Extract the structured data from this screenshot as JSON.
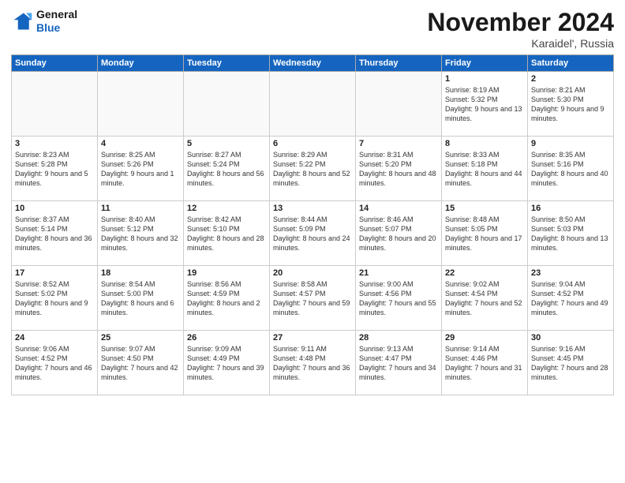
{
  "header": {
    "logo_line1": "General",
    "logo_line2": "Blue",
    "month_title": "November 2024",
    "location": "Karaidel', Russia"
  },
  "weekdays": [
    "Sunday",
    "Monday",
    "Tuesday",
    "Wednesday",
    "Thursday",
    "Friday",
    "Saturday"
  ],
  "weeks": [
    [
      {
        "day": "",
        "info": ""
      },
      {
        "day": "",
        "info": ""
      },
      {
        "day": "",
        "info": ""
      },
      {
        "day": "",
        "info": ""
      },
      {
        "day": "",
        "info": ""
      },
      {
        "day": "1",
        "info": "Sunrise: 8:19 AM\nSunset: 5:32 PM\nDaylight: 9 hours and 13 minutes."
      },
      {
        "day": "2",
        "info": "Sunrise: 8:21 AM\nSunset: 5:30 PM\nDaylight: 9 hours and 9 minutes."
      }
    ],
    [
      {
        "day": "3",
        "info": "Sunrise: 8:23 AM\nSunset: 5:28 PM\nDaylight: 9 hours and 5 minutes."
      },
      {
        "day": "4",
        "info": "Sunrise: 8:25 AM\nSunset: 5:26 PM\nDaylight: 9 hours and 1 minute."
      },
      {
        "day": "5",
        "info": "Sunrise: 8:27 AM\nSunset: 5:24 PM\nDaylight: 8 hours and 56 minutes."
      },
      {
        "day": "6",
        "info": "Sunrise: 8:29 AM\nSunset: 5:22 PM\nDaylight: 8 hours and 52 minutes."
      },
      {
        "day": "7",
        "info": "Sunrise: 8:31 AM\nSunset: 5:20 PM\nDaylight: 8 hours and 48 minutes."
      },
      {
        "day": "8",
        "info": "Sunrise: 8:33 AM\nSunset: 5:18 PM\nDaylight: 8 hours and 44 minutes."
      },
      {
        "day": "9",
        "info": "Sunrise: 8:35 AM\nSunset: 5:16 PM\nDaylight: 8 hours and 40 minutes."
      }
    ],
    [
      {
        "day": "10",
        "info": "Sunrise: 8:37 AM\nSunset: 5:14 PM\nDaylight: 8 hours and 36 minutes."
      },
      {
        "day": "11",
        "info": "Sunrise: 8:40 AM\nSunset: 5:12 PM\nDaylight: 8 hours and 32 minutes."
      },
      {
        "day": "12",
        "info": "Sunrise: 8:42 AM\nSunset: 5:10 PM\nDaylight: 8 hours and 28 minutes."
      },
      {
        "day": "13",
        "info": "Sunrise: 8:44 AM\nSunset: 5:09 PM\nDaylight: 8 hours and 24 minutes."
      },
      {
        "day": "14",
        "info": "Sunrise: 8:46 AM\nSunset: 5:07 PM\nDaylight: 8 hours and 20 minutes."
      },
      {
        "day": "15",
        "info": "Sunrise: 8:48 AM\nSunset: 5:05 PM\nDaylight: 8 hours and 17 minutes."
      },
      {
        "day": "16",
        "info": "Sunrise: 8:50 AM\nSunset: 5:03 PM\nDaylight: 8 hours and 13 minutes."
      }
    ],
    [
      {
        "day": "17",
        "info": "Sunrise: 8:52 AM\nSunset: 5:02 PM\nDaylight: 8 hours and 9 minutes."
      },
      {
        "day": "18",
        "info": "Sunrise: 8:54 AM\nSunset: 5:00 PM\nDaylight: 8 hours and 6 minutes."
      },
      {
        "day": "19",
        "info": "Sunrise: 8:56 AM\nSunset: 4:59 PM\nDaylight: 8 hours and 2 minutes."
      },
      {
        "day": "20",
        "info": "Sunrise: 8:58 AM\nSunset: 4:57 PM\nDaylight: 7 hours and 59 minutes."
      },
      {
        "day": "21",
        "info": "Sunrise: 9:00 AM\nSunset: 4:56 PM\nDaylight: 7 hours and 55 minutes."
      },
      {
        "day": "22",
        "info": "Sunrise: 9:02 AM\nSunset: 4:54 PM\nDaylight: 7 hours and 52 minutes."
      },
      {
        "day": "23",
        "info": "Sunrise: 9:04 AM\nSunset: 4:52 PM\nDaylight: 7 hours and 49 minutes."
      }
    ],
    [
      {
        "day": "24",
        "info": "Sunrise: 9:06 AM\nSunset: 4:52 PM\nDaylight: 7 hours and 46 minutes."
      },
      {
        "day": "25",
        "info": "Sunrise: 9:07 AM\nSunset: 4:50 PM\nDaylight: 7 hours and 42 minutes."
      },
      {
        "day": "26",
        "info": "Sunrise: 9:09 AM\nSunset: 4:49 PM\nDaylight: 7 hours and 39 minutes."
      },
      {
        "day": "27",
        "info": "Sunrise: 9:11 AM\nSunset: 4:48 PM\nDaylight: 7 hours and 36 minutes."
      },
      {
        "day": "28",
        "info": "Sunrise: 9:13 AM\nSunset: 4:47 PM\nDaylight: 7 hours and 34 minutes."
      },
      {
        "day": "29",
        "info": "Sunrise: 9:14 AM\nSunset: 4:46 PM\nDaylight: 7 hours and 31 minutes."
      },
      {
        "day": "30",
        "info": "Sunrise: 9:16 AM\nSunset: 4:45 PM\nDaylight: 7 hours and 28 minutes."
      }
    ]
  ]
}
